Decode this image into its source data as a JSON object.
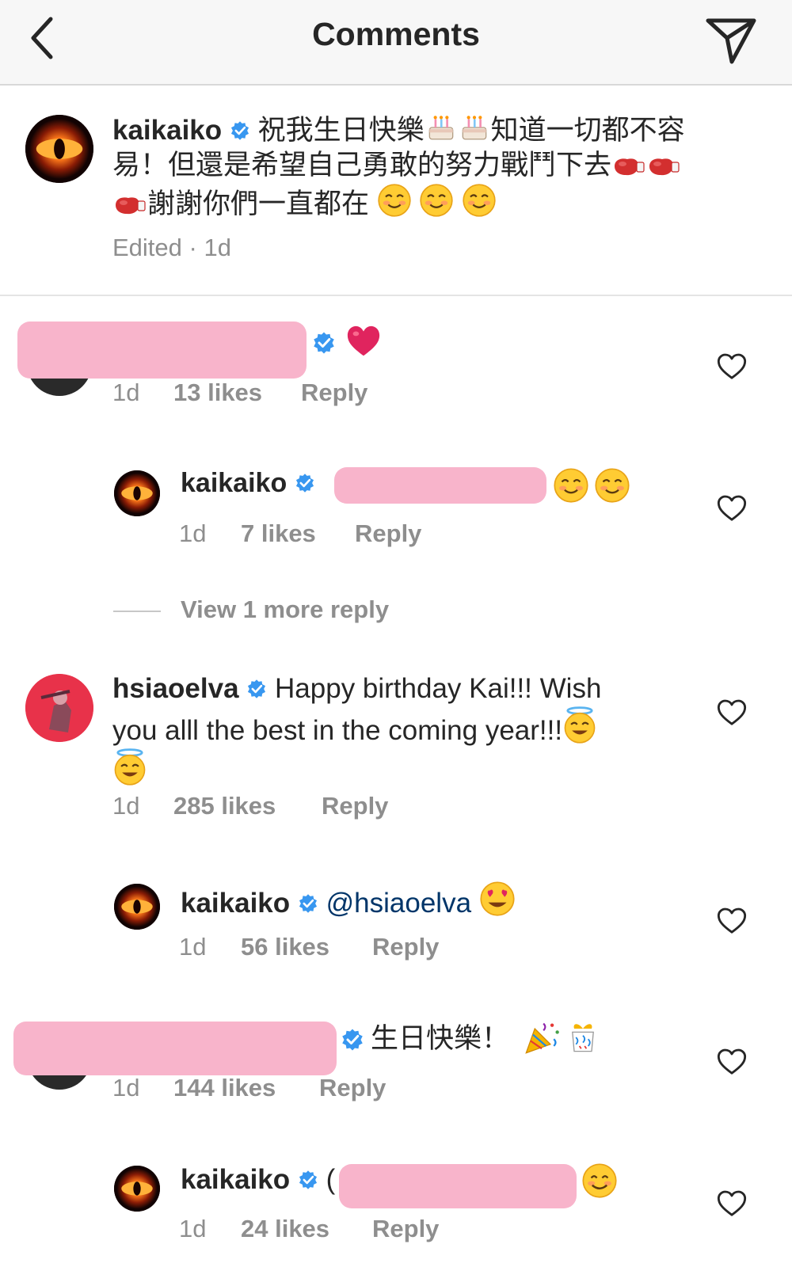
{
  "header": {
    "title": "Comments"
  },
  "caption": {
    "username": "kaikaiko",
    "text_line1": "祝我生日快樂",
    "text_line1b": "知道一切都不容",
    "text_line2": "易！但還是希望自己勇敢的努力戰鬥下去",
    "text_line3": "謝謝你們一直都在",
    "meta": "Edited · 1d"
  },
  "comments": [
    {
      "username": "",
      "time": "1d",
      "likes": "13 likes",
      "reply": "Reply"
    },
    {
      "username": "kaikaiko",
      "time": "1d",
      "likes": "7 likes",
      "reply": "Reply"
    },
    {
      "view_more": "View 1 more reply"
    },
    {
      "username": "hsiaoelva",
      "text_a": "Happy birthday Kai!!! Wish",
      "text_b": "you alll the best in the coming year!!!",
      "time": "1d",
      "likes": "285 likes",
      "reply": "Reply"
    },
    {
      "username": "kaikaiko",
      "mention": "@hsiaoelva",
      "time": "1d",
      "likes": "56 likes",
      "reply": "Reply"
    },
    {
      "text": "生日快樂！",
      "time": "1d",
      "likes": "144 likes",
      "reply": "Reply"
    },
    {
      "username": "kaikaiko",
      "text_fragment": "(",
      "time": "1d",
      "likes": "24 likes",
      "reply": "Reply"
    }
  ],
  "colors": {
    "verified": "#3897f0",
    "meta": "#8e8e8e",
    "redaction": "#f8b4cb",
    "mention": "#003569"
  },
  "icons": [
    "back-chevron-icon",
    "send-icon",
    "verified-badge-icon",
    "heart-outline-icon"
  ]
}
